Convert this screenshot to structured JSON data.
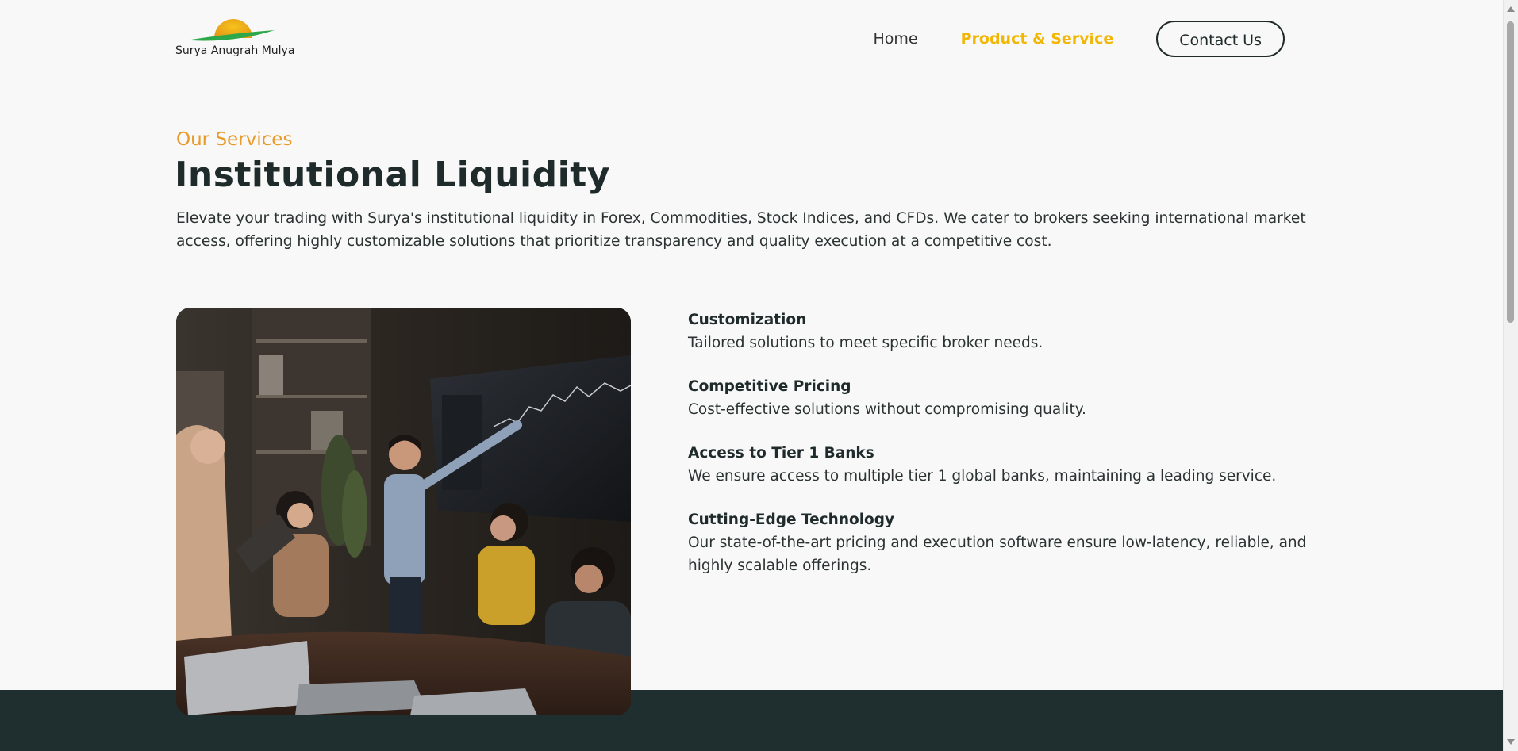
{
  "header": {
    "logo_text": "Surya Anugrah Mulya",
    "nav": {
      "home": "Home",
      "product_service": "Product & Service",
      "contact": "Contact Us"
    }
  },
  "intro": {
    "eyebrow": "Our Services",
    "title": "Institutional Liquidity",
    "description": "Elevate your trading with Surya's institutional liquidity in Forex, Commodities, Stock Indices, and CFDs. We cater to brokers seeking international market access, offering highly customizable solutions that prioritize transparency and quality execution at a competitive cost."
  },
  "features": [
    {
      "title": "Customization",
      "description": "Tailored solutions to meet specific broker needs."
    },
    {
      "title": "Competitive Pricing",
      "description": "Cost-effective solutions without compromising quality."
    },
    {
      "title": "Access to Tier 1 Banks",
      "description": "We ensure access to multiple tier 1 global banks, maintaining a leading service."
    },
    {
      "title": "Cutting-Edge Technology",
      "description": "Our state-of-the-art pricing and execution software ensure low-latency, reliable, and highly scalable offerings."
    }
  ],
  "colors": {
    "accent_yellow": "#f2b705",
    "eyebrow_orange": "#e89a2a",
    "dark_teal": "#1f2e2e",
    "background": "#f8f8f8"
  }
}
